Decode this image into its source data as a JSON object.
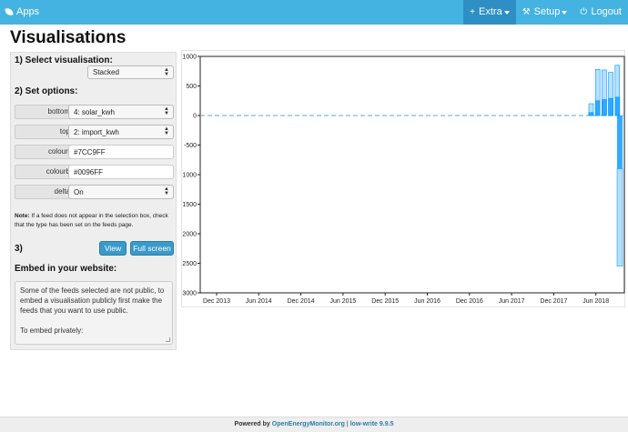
{
  "navbar": {
    "brand": "Apps",
    "items": [
      {
        "label": "Extra",
        "icon": "+"
      },
      {
        "label": "Setup",
        "icon": "⚒"
      },
      {
        "label": "Logout",
        "icon": "⏻"
      }
    ]
  },
  "page_title": "Visualisations",
  "panel": {
    "section1": "1) Select visualisation:",
    "visualisation": "Stacked",
    "section2": "2) Set options:",
    "options": [
      {
        "label": "bottom",
        "value": "4: solar_kwh",
        "type": "select"
      },
      {
        "label": "top",
        "value": "2: import_kwh",
        "type": "select"
      },
      {
        "label": "colourt",
        "value": "#7CC9FF",
        "type": "input"
      },
      {
        "label": "colourb",
        "value": "#0096FF",
        "type": "input"
      },
      {
        "label": "delta",
        "value": "On",
        "type": "select"
      }
    ],
    "note_bold": "Note:",
    "note_text": " If a feed does not appear in the selection box, check that the type has been set on the feeds page.",
    "section3": "3)",
    "view_button": "View",
    "fullscreen_button": "Full screen",
    "embed_title": "Embed in your website:",
    "embed_text1": "Some of the feeds selected are not public, to embed a visualisation publicly first make the feeds that you want to use public.",
    "embed_text2": "To embed privately:"
  },
  "chart_data": {
    "type": "bar",
    "ylim": [
      -3000,
      1000
    ],
    "yticks": [
      1000,
      500,
      0,
      -500,
      -1000,
      -1500,
      -2000,
      -2500,
      -3000
    ],
    "xticks": [
      "Dec 2013",
      "Jun 2014",
      "Dec 2014",
      "Jun 2015",
      "Dec 2015",
      "Jun 2016",
      "Dec 2016",
      "Jun 2017",
      "Dec 2017",
      "Jun 2018"
    ],
    "colors": {
      "top": "#7CC9FF",
      "bottom": "#0096FF"
    },
    "series": [
      {
        "name": "solar_kwh",
        "values": [
          50,
          250,
          270,
          290,
          310
        ]
      },
      {
        "name": "import_kwh",
        "values": [
          200,
          780,
          770,
          730,
          850
        ]
      }
    ],
    "negative_bar": {
      "bottom": -900,
      "top": -2550
    },
    "zero_line_dashed": true
  },
  "footer": {
    "powered": "Powered by ",
    "link": "OpenEnergyMonitor.org",
    "sep": " | ",
    "version": "low-write 9.9.5"
  }
}
